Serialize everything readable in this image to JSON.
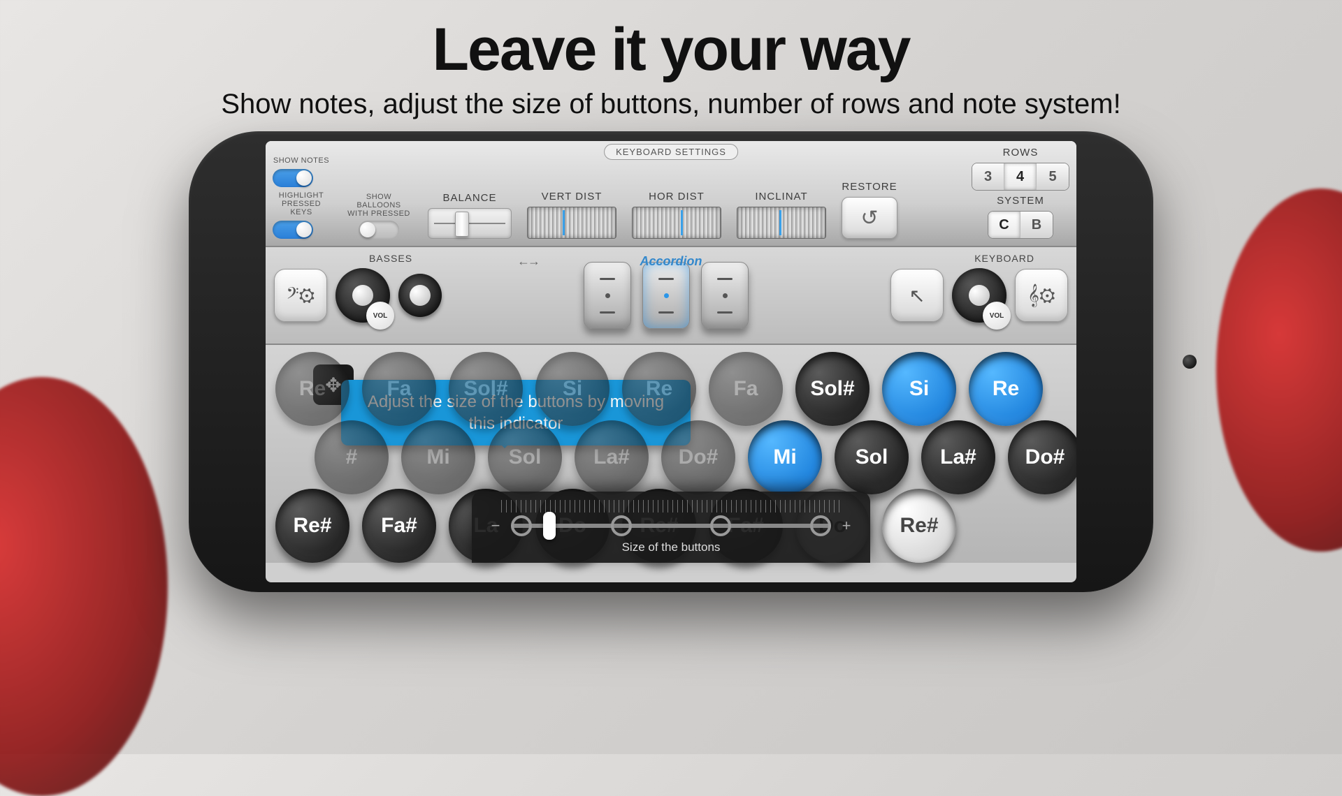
{
  "headline": {
    "title": "Leave it your way",
    "subtitle": "Show notes, adjust the size of buttons, number of rows and note system!"
  },
  "panel": {
    "pill": "KEYBOARD SETTINGS",
    "showNotes": "SHOW NOTES",
    "showBalloons": "SHOW BALLOONS WITH PRESSED",
    "highlight": "HIGHLIGHT PRESSED KEYS",
    "balance": "BALANCE",
    "vertDist": "VERT DIST",
    "horDist": "HOR DIST",
    "inclinat": "INCLINAT",
    "restore": "RESTORE",
    "rows": "ROWS",
    "system": "SYSTEM",
    "rowOptions": [
      "3",
      "4",
      "5"
    ],
    "sysOptions": [
      "C",
      "B"
    ]
  },
  "mid": {
    "basses": "BASSES",
    "keyboard": "KEYBOARD",
    "accordion": "Accordion",
    "vol": "VOL"
  },
  "keys": {
    "row1": [
      "Re",
      "Fa",
      "Sol#",
      "Si",
      "Re",
      "Fa",
      "Sol#",
      "Si",
      "Re"
    ],
    "row2": [
      "#",
      "Mi",
      "Sol",
      "La#",
      "Do#",
      "Mi",
      "Sol",
      "La#",
      "Do#"
    ],
    "row3": [
      "Re#",
      "Fa#",
      "La",
      "Do",
      "Re#",
      "Fa#",
      "Do",
      "Re#"
    ],
    "blueIdx1": [
      7,
      8
    ],
    "blueIdx2": [
      5
    ],
    "whiteIdx3": [
      6,
      7
    ]
  },
  "tooltip": "Adjust the size of the buttons by moving this indicator",
  "slider": {
    "label": "Size of the buttons",
    "minus": "−",
    "plus": "+"
  }
}
